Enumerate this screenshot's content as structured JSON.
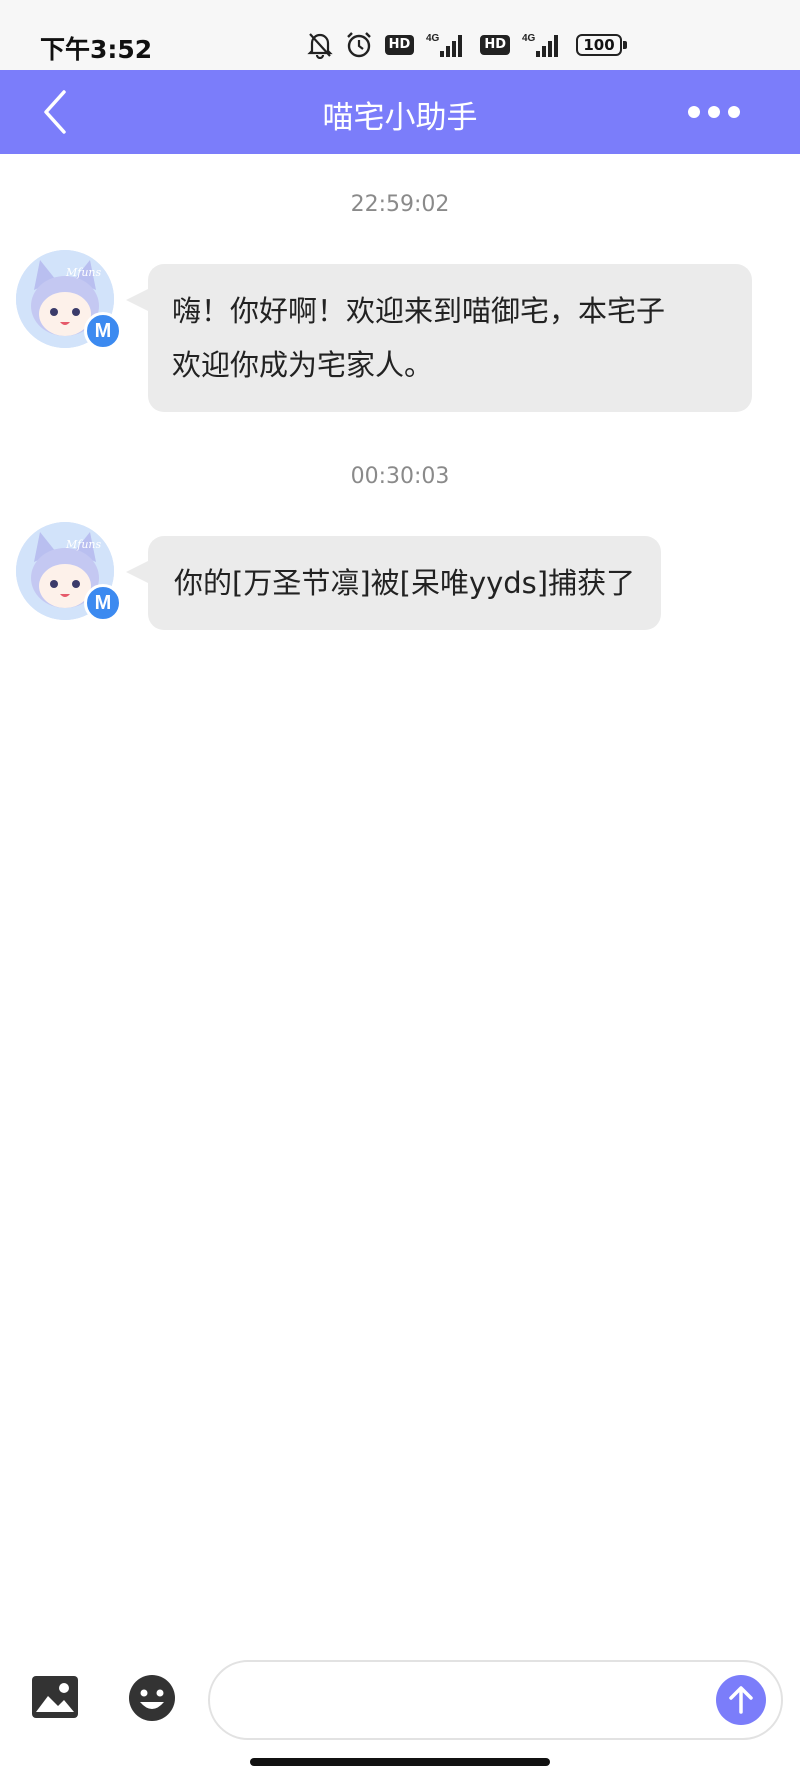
{
  "status_bar": {
    "time": "下午3:52",
    "hd1": "HD",
    "hd2": "HD",
    "network1": "4G",
    "network2": "4G",
    "battery": "100"
  },
  "header": {
    "title": "喵宅小助手"
  },
  "messages": [
    {
      "timestamp": "22:59:02",
      "line1": "嗨！你好啊！欢迎来到喵御宅，本宅子",
      "line2": "欢迎你成为宅家人。"
    },
    {
      "timestamp": "00:30:03",
      "text": "你的[万圣节凛]被[呆唯yyds]捕获了"
    }
  ],
  "avatar": {
    "watermark": "Mfuns",
    "badge": "M"
  },
  "input": {
    "placeholder": ""
  },
  "colors": {
    "accent": "#7b7dfa",
    "bubble": "#ebebeb"
  }
}
